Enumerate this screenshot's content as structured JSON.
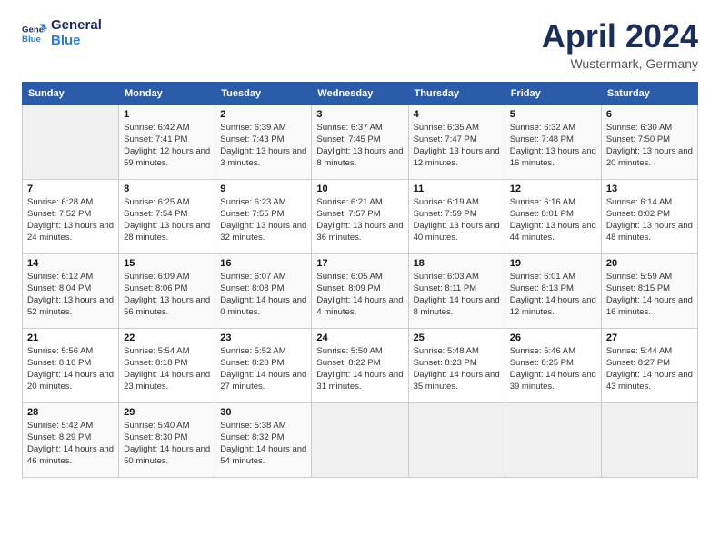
{
  "header": {
    "logo_line1": "General",
    "logo_line2": "Blue",
    "month_title": "April 2024",
    "subtitle": "Wustermark, Germany"
  },
  "calendar": {
    "days_of_week": [
      "Sunday",
      "Monday",
      "Tuesday",
      "Wednesday",
      "Thursday",
      "Friday",
      "Saturday"
    ],
    "weeks": [
      [
        {
          "day": "",
          "sunrise": "",
          "sunset": "",
          "daylight": ""
        },
        {
          "day": "1",
          "sunrise": "Sunrise: 6:42 AM",
          "sunset": "Sunset: 7:41 PM",
          "daylight": "Daylight: 12 hours and 59 minutes."
        },
        {
          "day": "2",
          "sunrise": "Sunrise: 6:39 AM",
          "sunset": "Sunset: 7:43 PM",
          "daylight": "Daylight: 13 hours and 3 minutes."
        },
        {
          "day": "3",
          "sunrise": "Sunrise: 6:37 AM",
          "sunset": "Sunset: 7:45 PM",
          "daylight": "Daylight: 13 hours and 8 minutes."
        },
        {
          "day": "4",
          "sunrise": "Sunrise: 6:35 AM",
          "sunset": "Sunset: 7:47 PM",
          "daylight": "Daylight: 13 hours and 12 minutes."
        },
        {
          "day": "5",
          "sunrise": "Sunrise: 6:32 AM",
          "sunset": "Sunset: 7:48 PM",
          "daylight": "Daylight: 13 hours and 16 minutes."
        },
        {
          "day": "6",
          "sunrise": "Sunrise: 6:30 AM",
          "sunset": "Sunset: 7:50 PM",
          "daylight": "Daylight: 13 hours and 20 minutes."
        }
      ],
      [
        {
          "day": "7",
          "sunrise": "Sunrise: 6:28 AM",
          "sunset": "Sunset: 7:52 PM",
          "daylight": "Daylight: 13 hours and 24 minutes."
        },
        {
          "day": "8",
          "sunrise": "Sunrise: 6:25 AM",
          "sunset": "Sunset: 7:54 PM",
          "daylight": "Daylight: 13 hours and 28 minutes."
        },
        {
          "day": "9",
          "sunrise": "Sunrise: 6:23 AM",
          "sunset": "Sunset: 7:55 PM",
          "daylight": "Daylight: 13 hours and 32 minutes."
        },
        {
          "day": "10",
          "sunrise": "Sunrise: 6:21 AM",
          "sunset": "Sunset: 7:57 PM",
          "daylight": "Daylight: 13 hours and 36 minutes."
        },
        {
          "day": "11",
          "sunrise": "Sunrise: 6:19 AM",
          "sunset": "Sunset: 7:59 PM",
          "daylight": "Daylight: 13 hours and 40 minutes."
        },
        {
          "day": "12",
          "sunrise": "Sunrise: 6:16 AM",
          "sunset": "Sunset: 8:01 PM",
          "daylight": "Daylight: 13 hours and 44 minutes."
        },
        {
          "day": "13",
          "sunrise": "Sunrise: 6:14 AM",
          "sunset": "Sunset: 8:02 PM",
          "daylight": "Daylight: 13 hours and 48 minutes."
        }
      ],
      [
        {
          "day": "14",
          "sunrise": "Sunrise: 6:12 AM",
          "sunset": "Sunset: 8:04 PM",
          "daylight": "Daylight: 13 hours and 52 minutes."
        },
        {
          "day": "15",
          "sunrise": "Sunrise: 6:09 AM",
          "sunset": "Sunset: 8:06 PM",
          "daylight": "Daylight: 13 hours and 56 minutes."
        },
        {
          "day": "16",
          "sunrise": "Sunrise: 6:07 AM",
          "sunset": "Sunset: 8:08 PM",
          "daylight": "Daylight: 14 hours and 0 minutes."
        },
        {
          "day": "17",
          "sunrise": "Sunrise: 6:05 AM",
          "sunset": "Sunset: 8:09 PM",
          "daylight": "Daylight: 14 hours and 4 minutes."
        },
        {
          "day": "18",
          "sunrise": "Sunrise: 6:03 AM",
          "sunset": "Sunset: 8:11 PM",
          "daylight": "Daylight: 14 hours and 8 minutes."
        },
        {
          "day": "19",
          "sunrise": "Sunrise: 6:01 AM",
          "sunset": "Sunset: 8:13 PM",
          "daylight": "Daylight: 14 hours and 12 minutes."
        },
        {
          "day": "20",
          "sunrise": "Sunrise: 5:59 AM",
          "sunset": "Sunset: 8:15 PM",
          "daylight": "Daylight: 14 hours and 16 minutes."
        }
      ],
      [
        {
          "day": "21",
          "sunrise": "Sunrise: 5:56 AM",
          "sunset": "Sunset: 8:16 PM",
          "daylight": "Daylight: 14 hours and 20 minutes."
        },
        {
          "day": "22",
          "sunrise": "Sunrise: 5:54 AM",
          "sunset": "Sunset: 8:18 PM",
          "daylight": "Daylight: 14 hours and 23 minutes."
        },
        {
          "day": "23",
          "sunrise": "Sunrise: 5:52 AM",
          "sunset": "Sunset: 8:20 PM",
          "daylight": "Daylight: 14 hours and 27 minutes."
        },
        {
          "day": "24",
          "sunrise": "Sunrise: 5:50 AM",
          "sunset": "Sunset: 8:22 PM",
          "daylight": "Daylight: 14 hours and 31 minutes."
        },
        {
          "day": "25",
          "sunrise": "Sunrise: 5:48 AM",
          "sunset": "Sunset: 8:23 PM",
          "daylight": "Daylight: 14 hours and 35 minutes."
        },
        {
          "day": "26",
          "sunrise": "Sunrise: 5:46 AM",
          "sunset": "Sunset: 8:25 PM",
          "daylight": "Daylight: 14 hours and 39 minutes."
        },
        {
          "day": "27",
          "sunrise": "Sunrise: 5:44 AM",
          "sunset": "Sunset: 8:27 PM",
          "daylight": "Daylight: 14 hours and 43 minutes."
        }
      ],
      [
        {
          "day": "28",
          "sunrise": "Sunrise: 5:42 AM",
          "sunset": "Sunset: 8:29 PM",
          "daylight": "Daylight: 14 hours and 46 minutes."
        },
        {
          "day": "29",
          "sunrise": "Sunrise: 5:40 AM",
          "sunset": "Sunset: 8:30 PM",
          "daylight": "Daylight: 14 hours and 50 minutes."
        },
        {
          "day": "30",
          "sunrise": "Sunrise: 5:38 AM",
          "sunset": "Sunset: 8:32 PM",
          "daylight": "Daylight: 14 hours and 54 minutes."
        },
        {
          "day": "",
          "sunrise": "",
          "sunset": "",
          "daylight": ""
        },
        {
          "day": "",
          "sunrise": "",
          "sunset": "",
          "daylight": ""
        },
        {
          "day": "",
          "sunrise": "",
          "sunset": "",
          "daylight": ""
        },
        {
          "day": "",
          "sunrise": "",
          "sunset": "",
          "daylight": ""
        }
      ]
    ]
  }
}
